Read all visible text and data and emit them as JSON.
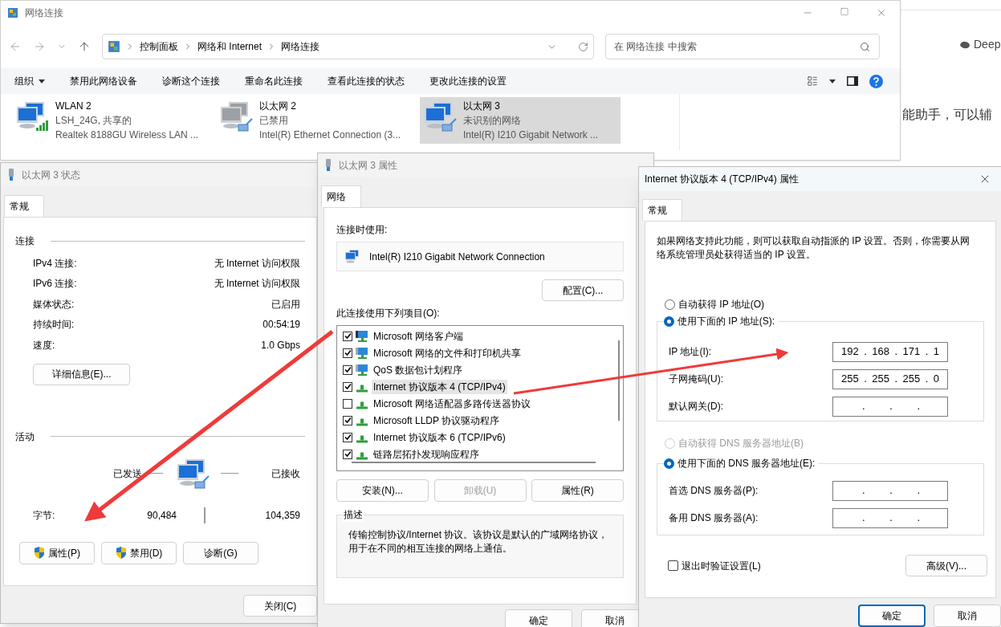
{
  "background": {
    "brand": "Deep",
    "text": "能助手，可以辅"
  },
  "explorer": {
    "title": "网络连接",
    "breadcrumb": [
      "控制面板",
      "网络和 Internet",
      "网络连接"
    ],
    "search": {
      "placeholder": "在 网络连接 中搜索"
    },
    "toolbar": [
      {
        "label": "组织",
        "dropdown": true
      },
      {
        "label": "禁用此网络设备",
        "dropdown": false
      },
      {
        "label": "诊断这个连接",
        "dropdown": false
      },
      {
        "label": "重命名此连接",
        "dropdown": false
      },
      {
        "label": "查看此连接的状态",
        "dropdown": false
      },
      {
        "label": "更改此连接的设置",
        "dropdown": false
      }
    ],
    "connections": [
      {
        "name": "WLAN 2",
        "status": "LSH_24G, 共享的",
        "device": "Realtek 8188GU Wireless LAN ...",
        "kind": "wifi",
        "enabled": true,
        "selected": false
      },
      {
        "name": "以太网 2",
        "status": "已禁用",
        "device": "Intel(R) Ethernet Connection (3...",
        "kind": "ethernet",
        "enabled": false,
        "selected": false
      },
      {
        "name": "以太网 3",
        "status": "未识别的网络",
        "device": "Intel(R) I210 Gigabit Network ...",
        "kind": "ethernet",
        "enabled": true,
        "selected": true
      }
    ]
  },
  "status_dialog": {
    "title": "以太网 3 状态",
    "tabs": [
      {
        "label": "常规",
        "selected": true
      }
    ],
    "connection": {
      "heading": "连接",
      "rows": [
        {
          "label": "IPv4 连接:",
          "value": "无 Internet 访问权限"
        },
        {
          "label": "IPv6 连接:",
          "value": "无 Internet 访问权限"
        },
        {
          "label": "媒体状态:",
          "value": "已启用"
        },
        {
          "label": "持续时间:",
          "value": "00:54:19"
        },
        {
          "label": "速度:",
          "value": "1.0 Gbps"
        }
      ]
    },
    "details_button": "详细信息(E)...",
    "activity": {
      "heading": "活动",
      "sent_label": "已发送",
      "received_label": "已接收",
      "bytes_label": "字节:",
      "sent": "90,484",
      "received": "104,359"
    },
    "buttons": [
      {
        "label": "属性(P)",
        "shield": true
      },
      {
        "label": "禁用(D)",
        "shield": true
      },
      {
        "label": "诊断(G)",
        "shield": false
      }
    ],
    "close_button": "关闭(C)"
  },
  "properties_dialog": {
    "title": "以太网 3 属性",
    "tabs": [
      {
        "label": "网络",
        "selected": true
      }
    ],
    "connect_using_label": "连接时使用:",
    "adapter": "Intel(R) I210 Gigabit Network Connection",
    "configure_button": "配置(C)...",
    "items_label": "此连接使用下列项目(O):",
    "items": [
      {
        "label": "Microsoft 网络客户端",
        "checked": true,
        "selected": false,
        "kind": "client"
      },
      {
        "label": "Microsoft 网络的文件和打印机共享",
        "checked": true,
        "selected": false,
        "kind": "service"
      },
      {
        "label": "QoS 数据包计划程序",
        "checked": true,
        "selected": false,
        "kind": "service"
      },
      {
        "label": "Internet 协议版本 4 (TCP/IPv4)",
        "checked": true,
        "selected": true,
        "kind": "protocol"
      },
      {
        "label": "Microsoft 网络适配器多路传送器协议",
        "checked": false,
        "selected": false,
        "kind": "protocol"
      },
      {
        "label": "Microsoft LLDP 协议驱动程序",
        "checked": true,
        "selected": false,
        "kind": "protocol"
      },
      {
        "label": "Internet 协议版本 6 (TCP/IPv6)",
        "checked": true,
        "selected": false,
        "kind": "protocol"
      },
      {
        "label": "链路层拓扑发现响应程序",
        "checked": true,
        "selected": false,
        "kind": "protocol"
      }
    ],
    "buttons": [
      {
        "label": "安装(N)...",
        "disabled": false
      },
      {
        "label": "卸载(U)",
        "disabled": true
      },
      {
        "label": "属性(R)",
        "disabled": false
      }
    ],
    "description": {
      "heading": "描述",
      "text": "传输控制协议/Internet 协议。该协议是默认的广域网络协议，用于在不同的相互连接的网络上通信。"
    },
    "footer_buttons": [
      {
        "label": "确定",
        "default": false
      },
      {
        "label": "取消",
        "default": false
      }
    ]
  },
  "ipv4_dialog": {
    "title": "Internet 协议版本 4 (TCP/IPv4) 属性",
    "tabs": [
      {
        "label": "常规",
        "selected": true
      }
    ],
    "intro": "如果网络支持此功能，则可以获取自动指派的 IP 设置。否则，你需要从网络系统管理员处获得适当的 IP 设置。",
    "ip_auto": {
      "label": "自动获得 IP 地址(O)",
      "selected": false,
      "disabled": false
    },
    "ip_manual": {
      "label": "使用下面的 IP 地址(S):",
      "selected": true,
      "disabled": false
    },
    "ip_fields": [
      {
        "label": "IP 地址(I):",
        "value": "192 . 168 . 171 . 1"
      },
      {
        "label": "子网掩码(U):",
        "value": "255 . 255 . 255 . 0"
      },
      {
        "label": "默认网关(D):",
        "value": ". . ."
      }
    ],
    "dns_auto": {
      "label": "自动获得 DNS 服务器地址(B)",
      "selected": false,
      "disabled": true
    },
    "dns_manual": {
      "label": "使用下面的 DNS 服务器地址(E):",
      "selected": true,
      "disabled": false
    },
    "dns_fields": [
      {
        "label": "首选 DNS 服务器(P):",
        "value": ". . ."
      },
      {
        "label": "备用 DNS 服务器(A):",
        "value": ". . ."
      }
    ],
    "validate": {
      "label": "退出时验证设置(L)",
      "checked": false
    },
    "advanced_button": "高级(V)...",
    "footer_buttons": [
      {
        "label": "确定",
        "default": true
      },
      {
        "label": "取消",
        "default": false
      }
    ]
  }
}
